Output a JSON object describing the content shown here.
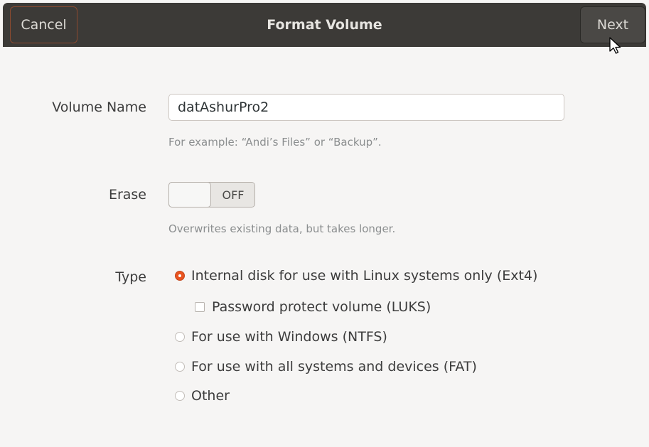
{
  "header": {
    "cancel_label": "Cancel",
    "title": "Format Volume",
    "next_label": "Next"
  },
  "form": {
    "volume_name": {
      "label": "Volume Name",
      "value": "datAshurPro2",
      "hint": "For example: “Andi’s Files” or “Backup”."
    },
    "erase": {
      "label": "Erase",
      "state": "OFF",
      "hint": "Overwrites existing data, but takes longer."
    },
    "type": {
      "label": "Type",
      "options": [
        {
          "label": "Internal disk for use with Linux systems only (Ext4)",
          "selected": true
        },
        {
          "label": "For use with Windows (NTFS)",
          "selected": false
        },
        {
          "label": "For use with all systems and devices (FAT)",
          "selected": false
        },
        {
          "label": "Other",
          "selected": false
        }
      ],
      "luks": {
        "label": "Password protect volume (LUKS)",
        "checked": false
      }
    }
  },
  "colors": {
    "header_bg": "#3c3a37",
    "accent": "#e95420"
  }
}
